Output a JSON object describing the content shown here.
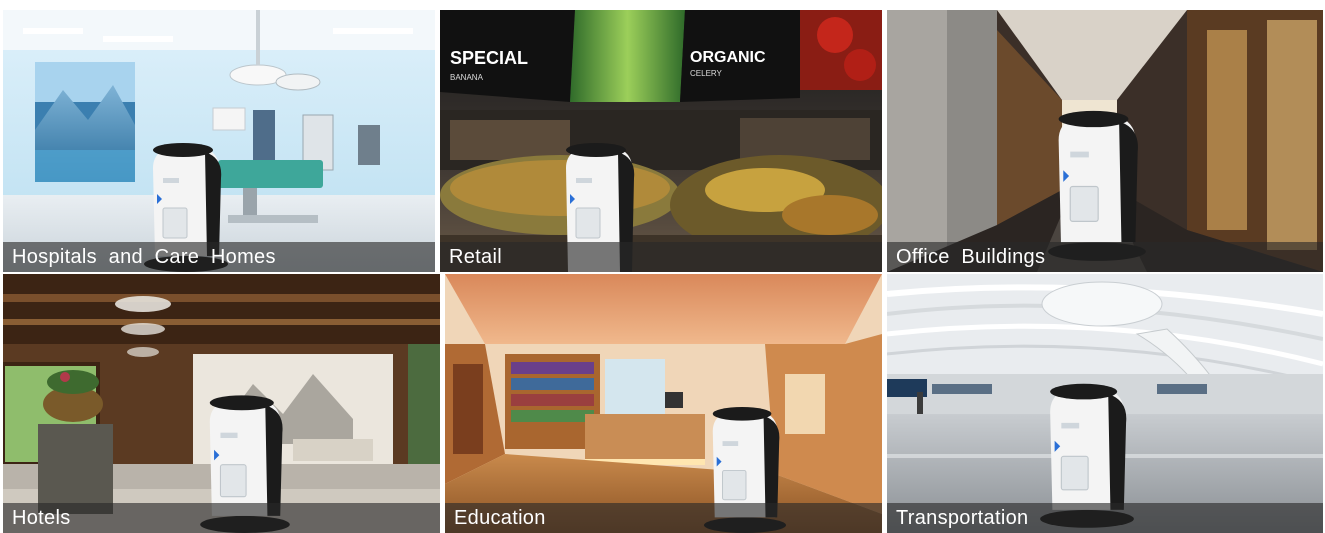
{
  "tiles": [
    {
      "label": "Hospitals  and  Care  Homes",
      "scene": "hospital-operating-room"
    },
    {
      "label": "Retail",
      "scene": "supermarket-produce"
    },
    {
      "label": "Office  Buildings",
      "scene": "office-corridor"
    },
    {
      "label": "Hotels",
      "scene": "hotel-lobby"
    },
    {
      "label": "Education",
      "scene": "library-reception"
    },
    {
      "label": "Transportation",
      "scene": "airport-terminal"
    }
  ],
  "signs": {
    "special": "SPECIAL",
    "banana": "BANANA",
    "organic": "ORGANIC",
    "celery": "CELERY"
  },
  "colors": {
    "caption_bg": "#3a3a3a",
    "caption_text": "#ffffff",
    "robot_body": "#f4f4f4",
    "robot_dark": "#1b1b1b",
    "robot_accent": "#2a6fd6"
  }
}
